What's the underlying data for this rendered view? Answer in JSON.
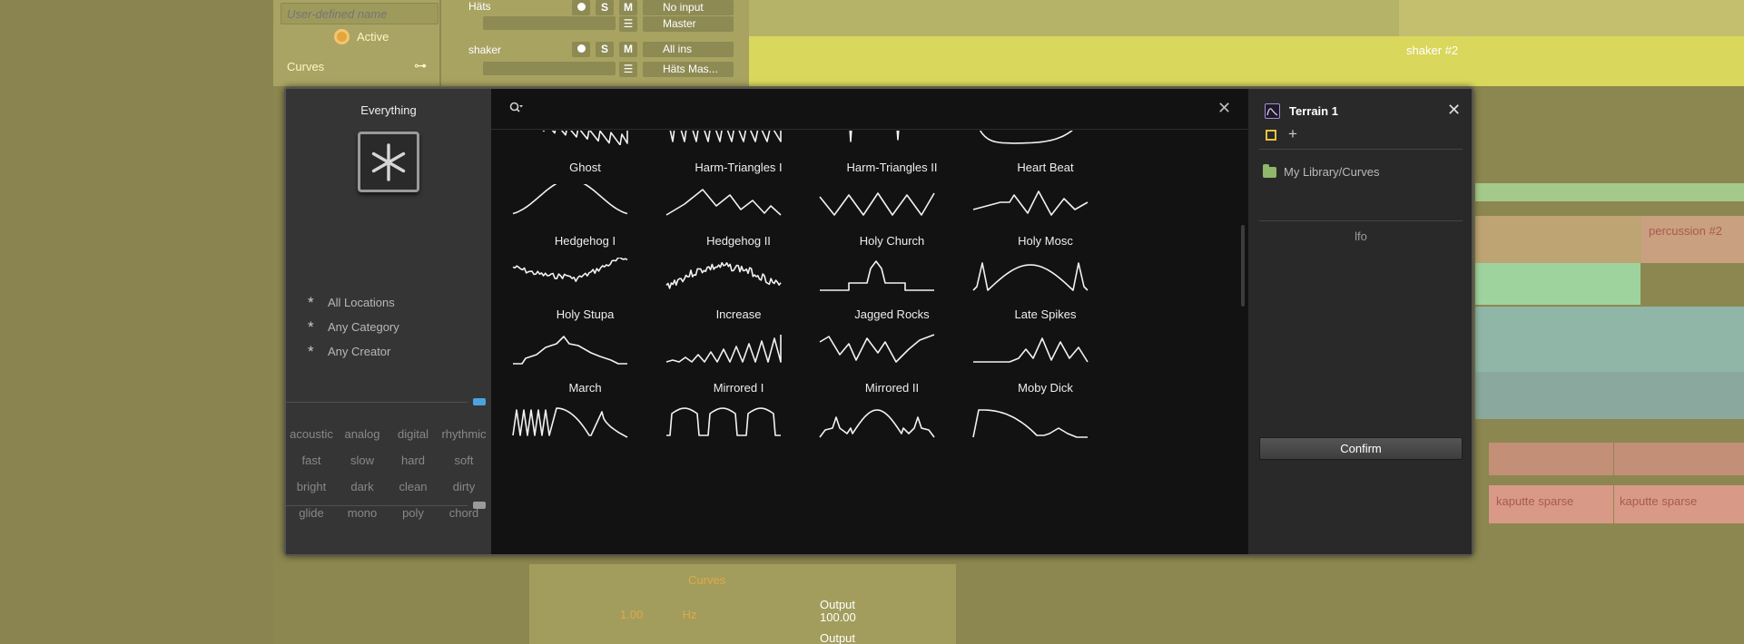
{
  "background": {
    "inspector": {
      "name_placeholder": "User-defined name",
      "active_label": "Active",
      "device_label": "Curves"
    },
    "tracks": [
      {
        "name": "Häts",
        "input": "No input",
        "output": "Master",
        "fader": 0.75
      },
      {
        "name": "shaker",
        "input": "All ins",
        "output": "Häts Mas...",
        "fader": 0.5
      }
    ],
    "clips": {
      "shaker": "shaker #2",
      "percussion": "percussion #2",
      "kaputte1": "kaputte sparse",
      "kaputte2": "kaputte sparse"
    },
    "device_panel": {
      "title": "Curves",
      "freq_value": "1.00",
      "freq_unit": "Hz",
      "output1_label": "Output",
      "output1_value": "100.00",
      "output2_label": "Output"
    },
    "buttons": {
      "solo": "S",
      "mute": "M"
    }
  },
  "browser": {
    "scope": {
      "title": "Everything"
    },
    "filters": [
      "All Locations",
      "Any Category",
      "Any Creator"
    ],
    "tags": [
      "acoustic",
      "analog",
      "digital",
      "rhythmic",
      "fast",
      "slow",
      "hard",
      "soft",
      "bright",
      "dark",
      "clean",
      "dirty",
      "glide",
      "mono",
      "poly",
      "chord"
    ],
    "search": {
      "value": "",
      "placeholder": ""
    },
    "results": [
      {
        "name": "",
        "wave": "sawdown"
      },
      {
        "name": "",
        "wave": "sawzig"
      },
      {
        "name": "",
        "wave": "spikes"
      },
      {
        "name": "",
        "wave": "bowl"
      },
      {
        "name": "Ghost",
        "wave": "ghost"
      },
      {
        "name": "Harm-Triangles I",
        "wave": "harm1"
      },
      {
        "name": "Harm-Triangles II",
        "wave": "harm2"
      },
      {
        "name": "Heart Beat",
        "wave": "heartbeat"
      },
      {
        "name": "Hedgehog I",
        "wave": "hedge1"
      },
      {
        "name": "Hedgehog II",
        "wave": "hedge2"
      },
      {
        "name": "Holy Church",
        "wave": "church"
      },
      {
        "name": "Holy Mosc",
        "wave": "mosc"
      },
      {
        "name": "Holy Stupa",
        "wave": "stupa"
      },
      {
        "name": "Increase",
        "wave": "increase"
      },
      {
        "name": "Jagged Rocks",
        "wave": "rocks"
      },
      {
        "name": "Late Spikes",
        "wave": "latespikes"
      },
      {
        "name": "March",
        "wave": "march"
      },
      {
        "name": "Mirrored I",
        "wave": "mirror1"
      },
      {
        "name": "Mirrored II",
        "wave": "mirror2"
      },
      {
        "name": "Moby Dick",
        "wave": "moby"
      }
    ],
    "detail": {
      "title": "Terrain 1",
      "location": "My Library/Curves",
      "category": "lfo",
      "confirm_label": "Confirm"
    }
  },
  "colors": {
    "accent": "#e3a53d",
    "tag_marker_blue": "#4aa3df",
    "terrain_icon": "#a58fd6",
    "swatch_yellow": "#e8c23e"
  }
}
